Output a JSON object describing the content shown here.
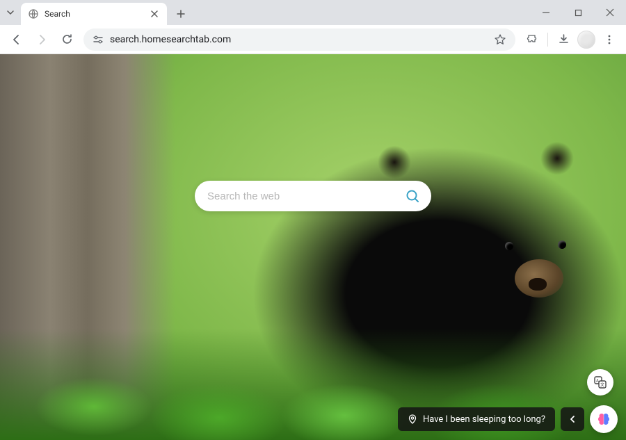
{
  "window": {
    "tab_title": "Search",
    "url": "search.homesearchtab.com"
  },
  "search": {
    "placeholder": "Search the web",
    "value": ""
  },
  "caption": {
    "text": "Have I been sleeping too long?"
  }
}
